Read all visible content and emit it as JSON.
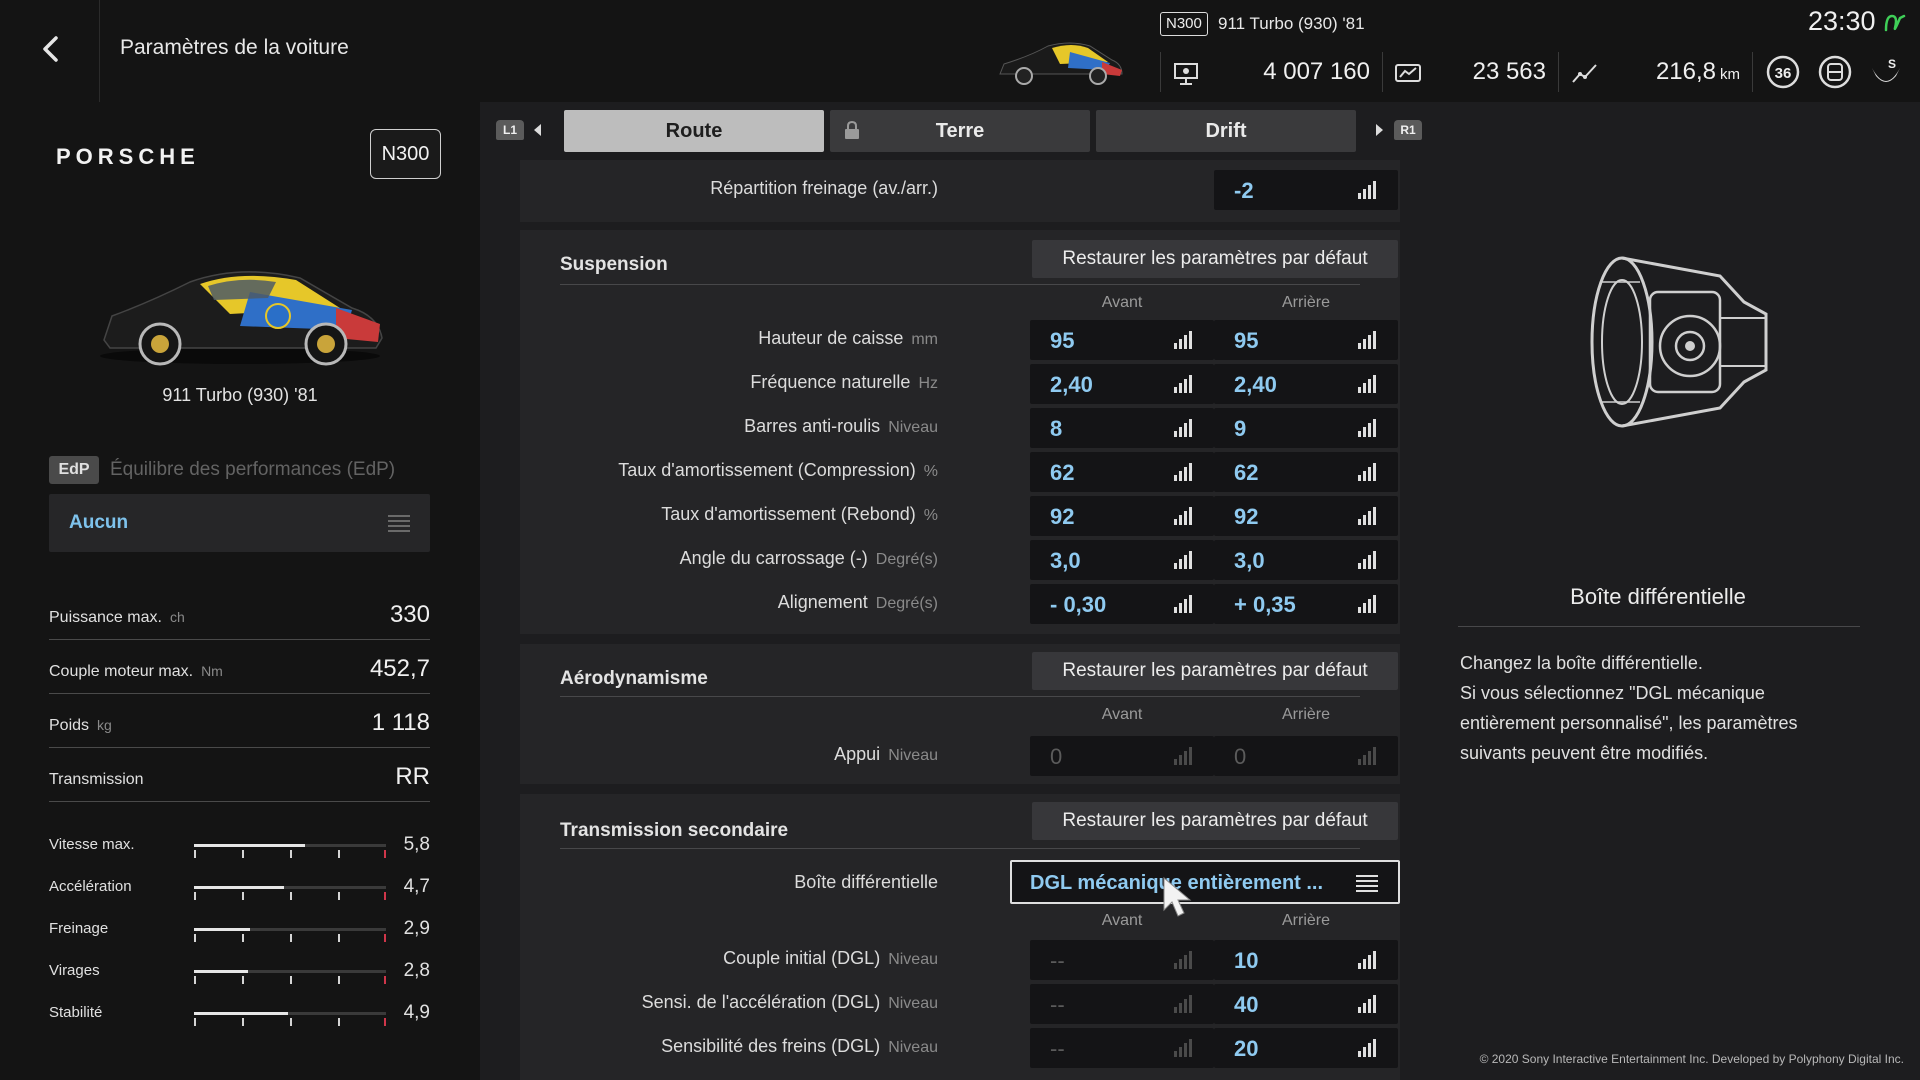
{
  "header": {
    "title": "Paramètres de la voiture",
    "car_class": "N300",
    "car_name": "911 Turbo (930) '81",
    "credits": "4 007 160",
    "mileage_points": "23 563",
    "distance": "216,8",
    "distance_unit": "km",
    "clock": "23:30",
    "level": "36"
  },
  "left": {
    "brand": "PORSCHE",
    "class": "N300",
    "car_name": "911 Turbo (930) '81",
    "edp_badge": "EdP",
    "edp_label": "Équilibre des performances (EdP)",
    "edp_value": "Aucun",
    "specs": [
      {
        "label": "Puissance max.",
        "unit": "ch",
        "value": "330"
      },
      {
        "label": "Couple moteur max.",
        "unit": "Nm",
        "value": "452,7"
      },
      {
        "label": "Poids",
        "unit": "kg",
        "value": "1 118"
      },
      {
        "label": "Transmission",
        "unit": "",
        "value": "RR"
      }
    ],
    "perf": [
      {
        "label": "Vitesse max.",
        "value": "5,8",
        "level": 0.58
      },
      {
        "label": "Accélération",
        "value": "4,7",
        "level": 0.47
      },
      {
        "label": "Freinage",
        "value": "2,9",
        "level": 0.29
      },
      {
        "label": "Virages",
        "value": "2,8",
        "level": 0.28
      },
      {
        "label": "Stabilité",
        "value": "4,9",
        "level": 0.49
      }
    ]
  },
  "tabs": {
    "left_shoulder": "L1",
    "right_shoulder": "R1",
    "items": [
      "Route",
      "Terre",
      "Drift"
    ]
  },
  "brake": {
    "label": "Répartition freinage (av./arr.)",
    "value": "-2"
  },
  "suspension": {
    "title": "Suspension",
    "reset": "Restaurer les paramètres par défaut",
    "col_front": "Avant",
    "col_rear": "Arrière",
    "rows": [
      {
        "label": "Hauteur de caisse",
        "unit": "mm",
        "front": "95",
        "rear": "95"
      },
      {
        "label": "Fréquence naturelle",
        "unit": "Hz",
        "front": "2,40",
        "rear": "2,40"
      },
      {
        "label": "Barres anti-roulis",
        "unit": "Niveau",
        "front": "8",
        "rear": "9"
      },
      {
        "label": "Taux d'amortissement (Compression)",
        "unit": "%",
        "front": "62",
        "rear": "62"
      },
      {
        "label": "Taux d'amortissement (Rebond)",
        "unit": "%",
        "front": "92",
        "rear": "92"
      },
      {
        "label": "Angle du carrossage (-)",
        "unit": "Degré(s)",
        "front": "3,0",
        "rear": "3,0"
      },
      {
        "label": "Alignement",
        "unit": "Degré(s)",
        "front": "- 0,30",
        "rear": "+ 0,35"
      }
    ]
  },
  "aero": {
    "title": "Aérodynamisme",
    "reset": "Restaurer les paramètres par défaut",
    "col_front": "Avant",
    "col_rear": "Arrière",
    "row": {
      "label": "Appui",
      "unit": "Niveau",
      "front": "0",
      "rear": "0"
    }
  },
  "drivetrain": {
    "title": "Transmission secondaire",
    "reset": "Restaurer les paramètres par défaut",
    "diff_label": "Boîte différentielle",
    "diff_value": "DGL mécanique entièrement ...",
    "col_front": "Avant",
    "col_rear": "Arrière",
    "rows": [
      {
        "label": "Couple initial (DGL)",
        "unit": "Niveau",
        "front": "--",
        "rear": "10"
      },
      {
        "label": "Sensi. de l'accélération (DGL)",
        "unit": "Niveau",
        "front": "--",
        "rear": "40"
      },
      {
        "label": "Sensibilité des freins (DGL)",
        "unit": "Niveau",
        "front": "--",
        "rear": "20"
      }
    ]
  },
  "info": {
    "title": "Boîte différentielle",
    "lines": [
      "Changez la boîte différentielle.",
      "Si vous sélectionnez \"DGL mécanique",
      "entièrement personnalisé\", les paramètres",
      "suivants peuvent être modifiés."
    ]
  },
  "footer": {
    "copyright": "© 2020 Sony Interactive Entertainment Inc. Developed by Polyphony Digital Inc."
  },
  "colors": {
    "accent": "#8fcaf0",
    "edp_accent": "#7ec2ec",
    "clock_icon": "#3fcf58",
    "red_tick": "#d0364a"
  }
}
